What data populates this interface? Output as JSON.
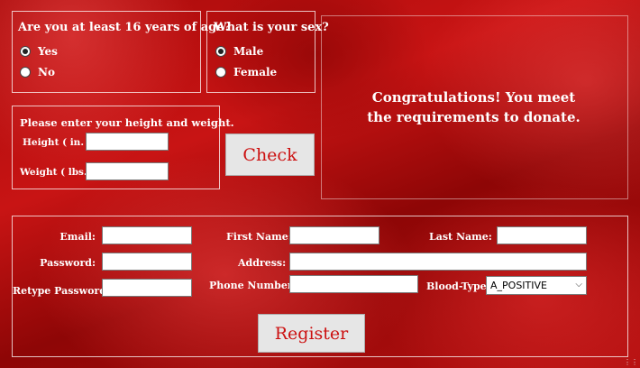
{
  "age": {
    "question": "Are you at least 16 years of age?",
    "options": [
      {
        "label": "Yes",
        "selected": true
      },
      {
        "label": "No",
        "selected": false
      }
    ]
  },
  "sex": {
    "question": "What is your sex?",
    "options": [
      {
        "label": "Male",
        "selected": true
      },
      {
        "label": "Female",
        "selected": false
      }
    ]
  },
  "measure": {
    "heading": "Please enter your height and weight.",
    "height_label": "Height ( in. ):",
    "weight_label": "Weight ( lbs. ):",
    "height_value": "",
    "weight_value": ""
  },
  "check_button": "Check",
  "result_message": "Congratulations! You meet the requirements to donate.",
  "registration": {
    "email_label": "Email:",
    "password_label": "Password:",
    "retype_label": "Retype Password:",
    "first_name_label": "First Name:",
    "address_label": "Address:",
    "phone_label": "Phone Number:",
    "last_name_label": "Last Name:",
    "blood_type_label": "Blood-Type:",
    "blood_type_value": "A_POSITIVE",
    "register_button": "Register"
  },
  "icons": {
    "select_chevron": "chevron-down-icon",
    "resize_grip": "resize-grip-icon"
  }
}
